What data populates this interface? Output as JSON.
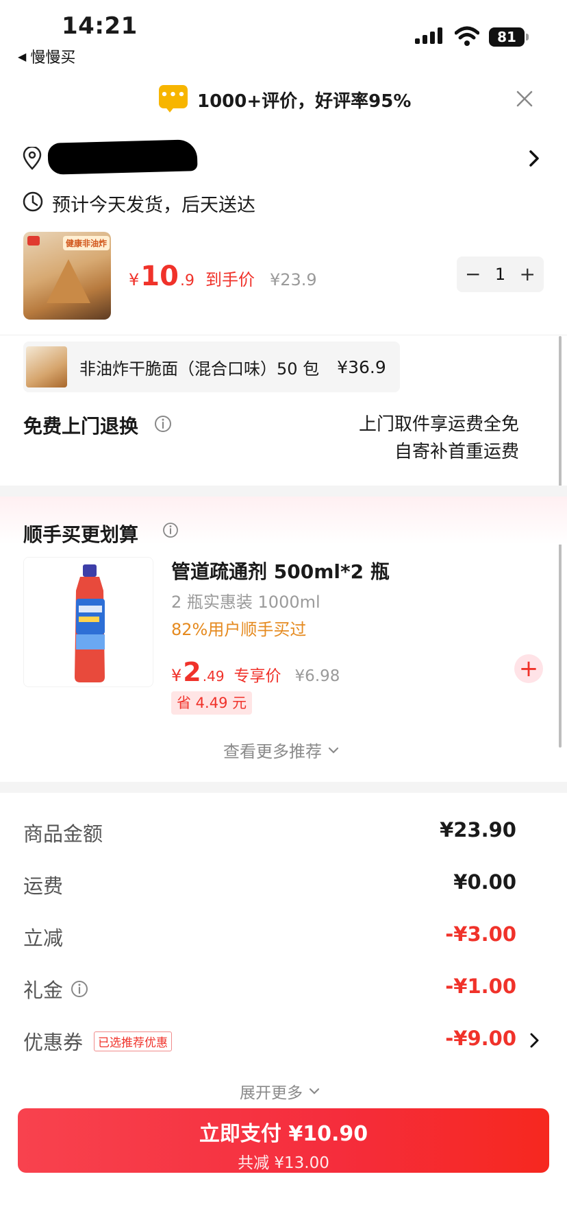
{
  "status_bar": {
    "time": "14:21",
    "back_app": "慢慢买",
    "battery": "81"
  },
  "banner": {
    "rating_text": "1000+评价，好评率95%"
  },
  "address": {
    "eta": "预计今天发货，后天送达"
  },
  "product": {
    "price_symbol": "¥",
    "price_int": "10",
    "price_dec": ".9",
    "price_label": "到手价",
    "original_price": "¥23.9",
    "quantity": "1"
  },
  "gift": {
    "name": "非油炸干脆面（混合口味）50 包",
    "price": "¥36.9"
  },
  "return_policy": {
    "title": "免费上门退换",
    "line1": "上门取件享运费全免",
    "line2": "自寄补首重运费"
  },
  "recommendation": {
    "title": "顺手买更划算",
    "item": {
      "name": "管道疏通剂 500ml*2 瓶",
      "subtitle": "2 瓶实惠装 1000ml",
      "buy_rate": "82%用户顺手买过",
      "price_symbol": "¥",
      "price_int": "2",
      "price_dec": ".49",
      "price_label": "专享价",
      "original_price": "¥6.98",
      "save": "省 4.49 元"
    },
    "more": "查看更多推荐"
  },
  "summary": {
    "rows": [
      {
        "label": "商品金额",
        "value": "¥23.90"
      },
      {
        "label": "运费",
        "value": "¥0.00"
      },
      {
        "label": "立减",
        "value": "-¥3.00"
      },
      {
        "label": "礼金",
        "value": "-¥1.00"
      },
      {
        "label": "优惠券",
        "value": "-¥9.00",
        "tag": "已选推荐优惠"
      }
    ],
    "expand_more": "展开更多"
  },
  "pay_button": {
    "label": "立即支付 ¥10.90",
    "sub": "共减 ¥13.00"
  },
  "colors": {
    "accent": "#f0322a",
    "orange": "#e58a1f",
    "banner_icon": "#f7b500"
  }
}
